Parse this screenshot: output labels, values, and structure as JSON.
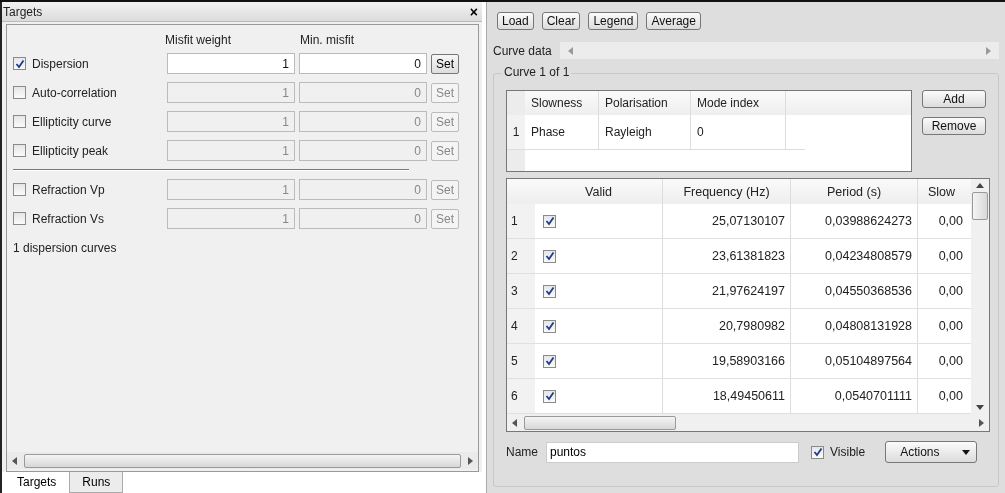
{
  "targets_panel": {
    "title": "Targets",
    "close": "×",
    "columns": [
      "Misfit weight",
      "Min. misfit"
    ],
    "groups": [
      [
        {
          "label": "Dispersion",
          "checked": true,
          "weight": "1",
          "min_misfit": "0",
          "button": "Set"
        },
        {
          "label": "Auto-correlation",
          "checked": false,
          "weight": "1",
          "min_misfit": "0",
          "button": "Set"
        },
        {
          "label": "Ellipticity curve",
          "checked": false,
          "weight": "1",
          "min_misfit": "0",
          "button": "Set"
        },
        {
          "label": "Ellipticity peak",
          "checked": false,
          "weight": "1",
          "min_misfit": "0",
          "button": "Set"
        }
      ],
      [
        {
          "label": "Refraction Vp",
          "checked": false,
          "weight": "1",
          "min_misfit": "0",
          "button": "Set"
        },
        {
          "label": "Refraction Vs",
          "checked": false,
          "weight": "1",
          "min_misfit": "0",
          "button": "Set"
        }
      ]
    ],
    "note": "1 dispersion curves",
    "tabs": [
      {
        "label": "Targets",
        "selected": true
      },
      {
        "label": "Runs",
        "selected": false
      }
    ]
  },
  "curves_panel": {
    "toolbar": [
      "Load",
      "Clear",
      "Legend",
      "Average"
    ],
    "curve_data_label": "Curve data",
    "group_title": "Curve 1 of 1",
    "modes": {
      "columns": [
        "Slowness",
        "Polarisation",
        "Mode index"
      ],
      "rows": [
        {
          "index": "1",
          "cells": [
            "Phase",
            "Rayleigh",
            "0"
          ]
        }
      ]
    },
    "mode_buttons": [
      "Add",
      "Remove"
    ],
    "points": {
      "columns": [
        "Valid",
        "Frequency (Hz)",
        "Period (s)",
        "Slow"
      ],
      "rows": [
        {
          "index": "1",
          "valid": true,
          "frequency": "25,07130107",
          "period": "0,03988624273",
          "slow": "0,00"
        },
        {
          "index": "2",
          "valid": true,
          "frequency": "23,61381823",
          "period": "0,04234808579",
          "slow": "0,00"
        },
        {
          "index": "3",
          "valid": true,
          "frequency": "21,97624197",
          "period": "0,04550368536",
          "slow": "0,00"
        },
        {
          "index": "4",
          "valid": true,
          "frequency": "20,7980982",
          "period": "0,04808131928",
          "slow": "0,00"
        },
        {
          "index": "5",
          "valid": true,
          "frequency": "19,58903166",
          "period": "0,05104897564",
          "slow": "0,00"
        },
        {
          "index": "6",
          "valid": true,
          "frequency": "18,49450611",
          "period": "0,0540701111",
          "slow": "0,00"
        }
      ]
    },
    "name_label": "Name",
    "name_value": "puntos",
    "visible": {
      "label": "Visible",
      "checked": true
    },
    "actions": "Actions"
  }
}
